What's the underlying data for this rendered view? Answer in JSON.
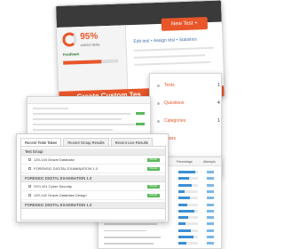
{
  "top_screen": {
    "percent": "95%",
    "percent_sub": "correct tests",
    "feedback_label": "Feedback",
    "new_test_button": "New Test +",
    "nav_text": "Edit test  •  Assign test  •  Statistics",
    "banner_text": "Create Custom Tes"
  },
  "right_screen": {
    "items": [
      {
        "label": "Tests",
        "value": "1"
      },
      {
        "label": "Questions",
        "value": "4"
      },
      {
        "label": "Categories",
        "value": "1"
      },
      {
        "label": "Users",
        "value": ""
      }
    ],
    "footer_label": "questions"
  },
  "front_screen": {
    "tabs": [
      {
        "label": "Recent Tests Taken",
        "active": true
      },
      {
        "label": "Recent Group Results",
        "active": false
      },
      {
        "label": "Recent Live Results",
        "active": false
      }
    ],
    "groups": [
      {
        "name": "Test Group",
        "rows": [
          "1Z0-144 Oracle Database",
          "FORENSIC DIGITAL EXAMINATION 1.0"
        ]
      },
      {
        "name": "FORENSIC DIGITAL EXAMINATION 1.0",
        "rows": [
          "SY0-101 Cyber Security",
          "1Z0-142 Oracle Database Design"
        ]
      },
      {
        "name": "FORENSIC DIGITAL EXAMINATION 1.0",
        "rows": []
      }
    ],
    "row_button": "Results"
  },
  "bottom_right_screen": {
    "headers": [
      "Percentage",
      "Attempts"
    ],
    "progress": [
      0.85,
      0.55,
      0.7,
      0.3,
      0.6,
      0.45,
      0.8,
      0.5,
      0.35,
      0.65,
      0.75,
      0.4
    ]
  },
  "colors": {
    "accent": "#e8562a",
    "success": "#5cb85c",
    "link": "#3a6ea5",
    "bar": "#3a8fd6"
  }
}
